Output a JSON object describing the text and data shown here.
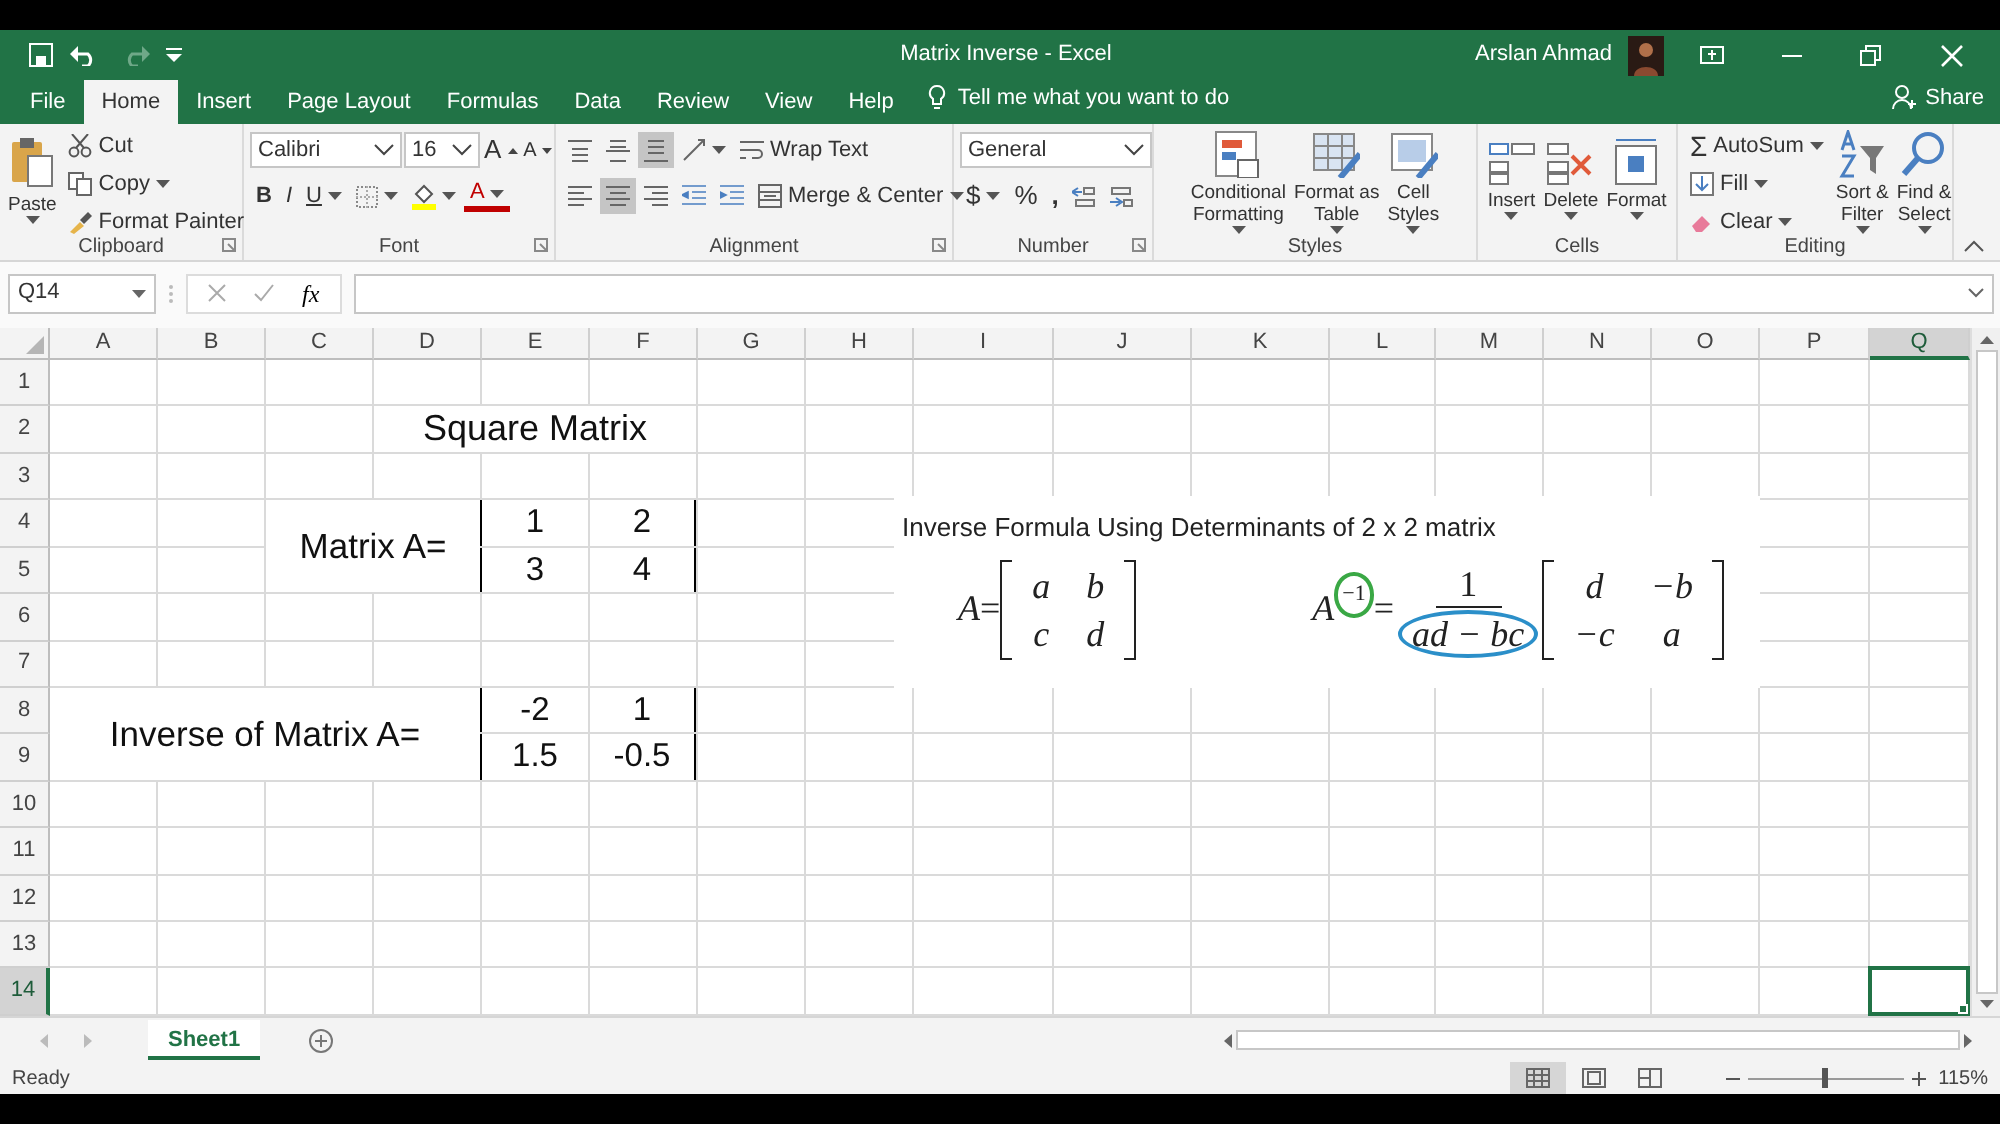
{
  "title_bar": {
    "title": "Matrix Inverse  -  Excel",
    "user": "Arslan Ahmad"
  },
  "menu_tabs": [
    {
      "label": "File",
      "selected": false
    },
    {
      "label": "Home",
      "selected": true
    },
    {
      "label": "Insert",
      "selected": false
    },
    {
      "label": "Page Layout",
      "selected": false
    },
    {
      "label": "Formulas",
      "selected": false
    },
    {
      "label": "Data",
      "selected": false
    },
    {
      "label": "Review",
      "selected": false
    },
    {
      "label": "View",
      "selected": false
    },
    {
      "label": "Help",
      "selected": false
    }
  ],
  "tell_me": "Tell me what you want to do",
  "share": "Share",
  "ribbon": {
    "clipboard": {
      "paste": "Paste",
      "cut": "Cut",
      "copy": "Copy",
      "format_painter": "Format Painter",
      "label": "Clipboard"
    },
    "font": {
      "name": "Calibri",
      "size": "16",
      "grow": "A",
      "shrink": "A",
      "bold": "B",
      "italic": "I",
      "underline": "U",
      "font_color": "A",
      "label": "Font"
    },
    "alignment": {
      "align_buttons": [
        {
          "kind": "top",
          "selected": false
        },
        {
          "kind": "middle",
          "selected": false
        },
        {
          "kind": "bottom",
          "selected": true
        },
        {
          "kind": "left",
          "selected": false
        },
        {
          "kind": "center",
          "selected": true
        },
        {
          "kind": "right",
          "selected": false
        }
      ],
      "wrap_text": "Wrap Text",
      "merge_center": "Merge & Center",
      "label": "Alignment"
    },
    "number": {
      "format": "General",
      "currency": "$",
      "percent": "%",
      "comma": ",",
      "label": "Number"
    },
    "styles": {
      "buttons": [
        {
          "kind": "conditional",
          "lines": [
            "Conditional",
            "Formatting"
          ]
        },
        {
          "kind": "table",
          "lines": [
            "Format as",
            "Table"
          ]
        },
        {
          "kind": "cell_styles",
          "lines": [
            "Cell",
            "Styles"
          ]
        }
      ],
      "label": "Styles"
    },
    "cells": {
      "buttons": [
        {
          "kind": "insert",
          "lines": [
            "Insert"
          ]
        },
        {
          "kind": "delete",
          "lines": [
            "Delete"
          ]
        },
        {
          "kind": "format",
          "lines": [
            "Format"
          ]
        }
      ],
      "label": "Cells"
    },
    "editing": {
      "sigma": "Σ",
      "autosum": "AutoSum",
      "fill": "Fill",
      "clear": "Clear",
      "buttons": [
        {
          "kind": "sort",
          "lines": [
            "Sort &",
            "Filter"
          ]
        },
        {
          "kind": "find",
          "lines": [
            "Find &",
            "Select"
          ]
        }
      ],
      "label": "Editing"
    }
  },
  "formula_bar": {
    "name_box": "Q14",
    "function_label": "fx"
  },
  "columns": [
    {
      "label": "A",
      "selected": false
    },
    {
      "label": "B",
      "selected": false
    },
    {
      "label": "C",
      "selected": false
    },
    {
      "label": "D",
      "selected": false
    },
    {
      "label": "E",
      "selected": false
    },
    {
      "label": "F",
      "selected": false
    },
    {
      "label": "G",
      "selected": false
    },
    {
      "label": "H",
      "selected": false
    },
    {
      "label": "I",
      "selected": false
    },
    {
      "label": "J",
      "selected": false
    },
    {
      "label": "K",
      "selected": false
    },
    {
      "label": "L",
      "selected": false
    },
    {
      "label": "M",
      "selected": false
    },
    {
      "label": "N",
      "selected": false
    },
    {
      "label": "O",
      "selected": false
    },
    {
      "label": "P",
      "selected": false
    },
    {
      "label": "Q",
      "selected": true
    }
  ],
  "rows": [
    {
      "label": "1",
      "selected": false
    },
    {
      "label": "2",
      "selected": false
    },
    {
      "label": "3",
      "selected": false
    },
    {
      "label": "4",
      "selected": false
    },
    {
      "label": "5",
      "selected": false
    },
    {
      "label": "6",
      "selected": false
    },
    {
      "label": "7",
      "selected": false
    },
    {
      "label": "8",
      "selected": false
    },
    {
      "label": "9",
      "selected": false
    },
    {
      "label": "10",
      "selected": false
    },
    {
      "label": "11",
      "selected": false
    },
    {
      "label": "12",
      "selected": false
    },
    {
      "label": "13",
      "selected": false
    },
    {
      "label": "14",
      "selected": true
    }
  ],
  "cells": [
    {
      "kind": "title",
      "text": "Square Matrix"
    },
    {
      "kind": "label",
      "text": "Matrix A="
    },
    {
      "kind": "value",
      "text": "1",
      "bordered": true
    },
    {
      "kind": "value",
      "text": "2",
      "bordered": true
    },
    {
      "kind": "value",
      "text": "3",
      "bordered": true
    },
    {
      "kind": "value",
      "text": "4",
      "bordered": true
    },
    {
      "kind": "label",
      "text": "Inverse of Matrix A="
    },
    {
      "kind": "value",
      "text": "-2",
      "bordered": true
    },
    {
      "kind": "value",
      "text": "1",
      "bordered": true
    },
    {
      "kind": "value",
      "text": "1.5",
      "bordered": true
    },
    {
      "kind": "value",
      "text": "-0.5",
      "bordered": true
    }
  ],
  "formula_image": {
    "caption": "Inverse Formula Using Determinants of 2 x 2 matrix",
    "formulas": [
      {
        "kind": "matrix",
        "symbol": "A",
        "equals": "=",
        "matrix": [
          [
            "a",
            "b"
          ],
          [
            "c",
            "d"
          ]
        ]
      },
      {
        "kind": "inverse",
        "symbol": "A",
        "exponent": "−1",
        "equals": "=",
        "numerator": "1",
        "denominator": "ad − bc",
        "matrix": [
          [
            "d",
            "−b"
          ],
          [
            "−c",
            "a"
          ]
        ]
      }
    ]
  },
  "sheet_tabs": [
    {
      "label": "Sheet1",
      "selected": true
    }
  ],
  "status_bar": {
    "status": "Ready",
    "views": [
      {
        "kind": "normal",
        "selected": true
      },
      {
        "kind": "page_layout",
        "selected": false
      },
      {
        "kind": "page_break",
        "selected": false
      }
    ],
    "zoom_slider": {
      "level": 0.47
    },
    "zoom": "115%"
  }
}
